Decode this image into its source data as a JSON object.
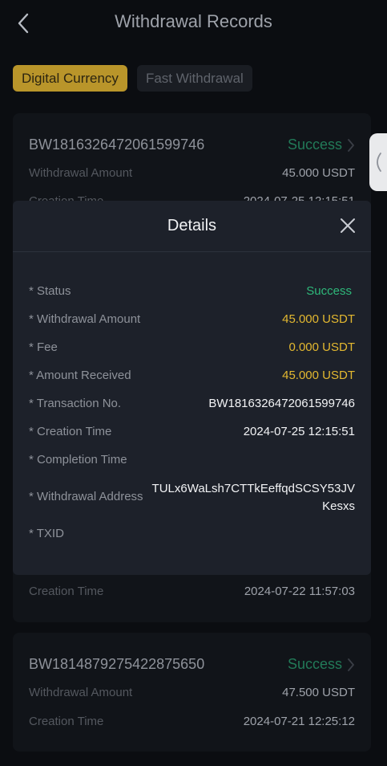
{
  "header": {
    "title": "Withdrawal Records",
    "back_icon": "chevron-left-icon"
  },
  "tabs": [
    {
      "label": "Digital Currency",
      "active": true
    },
    {
      "label": "Fast Withdrawal",
      "active": false
    }
  ],
  "records": [
    {
      "order_no": "BW1816326472061599746",
      "status": "Success",
      "amount_label": "Withdrawal Amount",
      "amount": "45.000 USDT",
      "time_label": "Creation Time",
      "time": "2024-07-25 12:15:51"
    },
    {
      "time_label": "Creation Time",
      "time": "2024-07-22 11:57:03"
    },
    {
      "order_no": "BW1814879275422875650",
      "status": "Success",
      "amount_label": "Withdrawal Amount",
      "amount": "47.500 USDT",
      "time_label": "Creation Time",
      "time": "2024-07-21 12:25:12"
    }
  ],
  "details": {
    "title": "Details",
    "close_icon": "close-icon",
    "rows": [
      {
        "label": "* Status",
        "value": "Success"
      },
      {
        "label": "* Withdrawal Amount",
        "value": "45.000 USDT"
      },
      {
        "label": "* Fee",
        "value": "0.000 USDT"
      },
      {
        "label": "* Amount Received",
        "value": "45.000 USDT"
      },
      {
        "label": "* Transaction No.",
        "value": "BW1816326472061599746"
      },
      {
        "label": "* Creation Time",
        "value": "2024-07-25 12:15:51"
      },
      {
        "label": "* Completion Time",
        "value": ""
      },
      {
        "label": "* Withdrawal Address",
        "value": "TULx6WaLsh7CTTkEeffqdSCSY53JVKesxs"
      },
      {
        "label": "* TXID",
        "value": ""
      }
    ]
  },
  "colors": {
    "background": "#0b0d11",
    "card": "#111419",
    "modal": "#1d212a",
    "accent": "#b9952a",
    "success": "#2eb87a",
    "amount": "#e3b830"
  }
}
